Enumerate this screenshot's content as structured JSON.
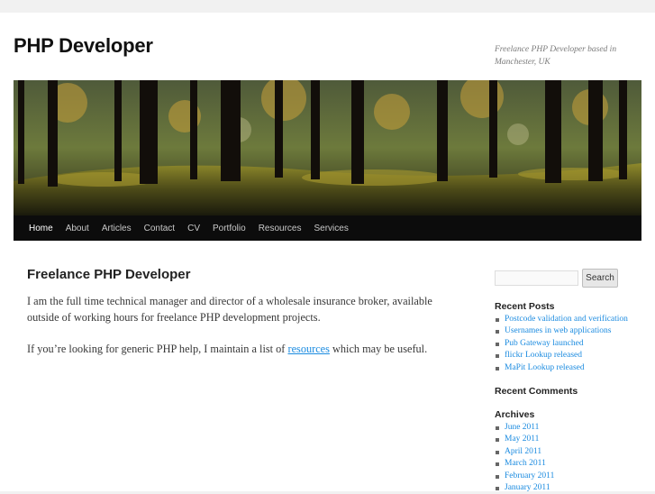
{
  "site": {
    "title": "PHP Developer",
    "tagline": "Freelance PHP Developer based in Manchester, UK"
  },
  "nav": {
    "items": [
      "Home",
      "About",
      "Articles",
      "Contact",
      "CV",
      "Portfolio",
      "Resources",
      "Services"
    ],
    "active": "Home"
  },
  "post": {
    "title": "Freelance PHP Developer",
    "paragraph1": "I am the full time technical manager and director of a wholesale insurance broker, available outside of working hours for freelance PHP development projects.",
    "paragraph2_before": "If you’re looking for generic PHP help, I maintain a list of ",
    "paragraph2_link": "resources",
    "paragraph2_after": " which may be useful."
  },
  "sidebar": {
    "search_button": "Search",
    "search_value": "",
    "recent_posts_title": "Recent Posts",
    "recent_posts": [
      "Postcode validation and verification",
      "Usernames in web applications",
      "Pub Gateway launched",
      "flickr Lookup released",
      "MaPit Lookup released"
    ],
    "recent_comments_title": "Recent Comments",
    "archives_title": "Archives",
    "archives": [
      "June 2011",
      "May 2011",
      "April 2011",
      "March 2011",
      "February 2011",
      "January 2011"
    ]
  },
  "colors": {
    "link": "#1b8be0",
    "nav_bg": "#0c0c0c"
  }
}
